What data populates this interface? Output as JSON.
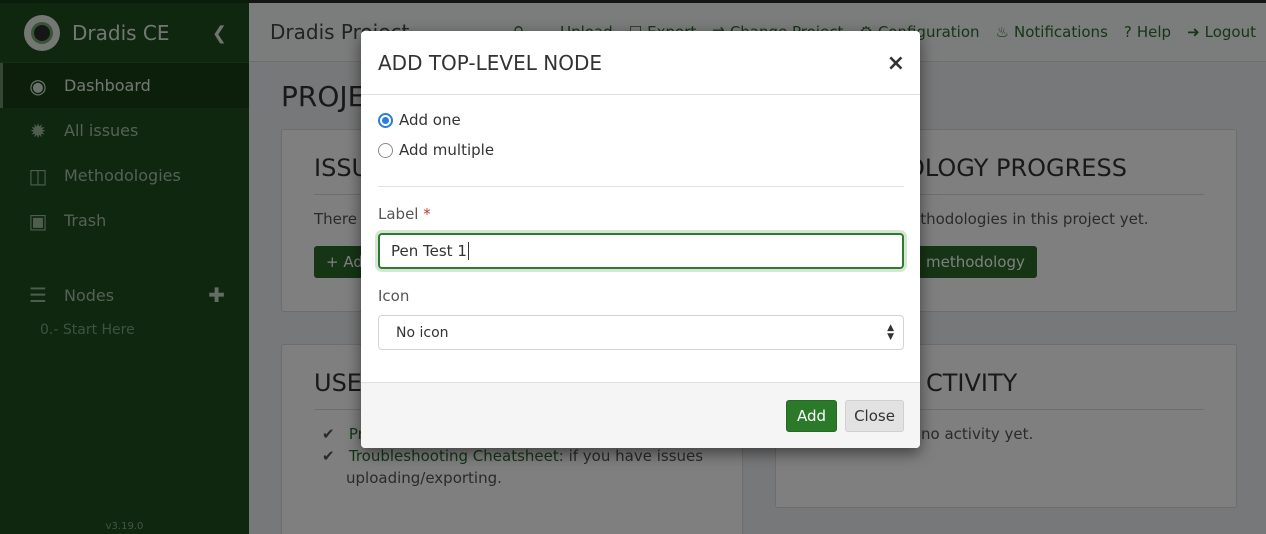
{
  "sidebar": {
    "brand": "Dradis CE",
    "items": [
      {
        "label": "Dashboard",
        "icon": "dashboard-icon"
      },
      {
        "label": "All issues",
        "icon": "bug-icon"
      },
      {
        "label": "Methodologies",
        "icon": "board-icon"
      },
      {
        "label": "Trash",
        "icon": "trash-icon"
      }
    ],
    "nodes_label": "Nodes",
    "nodes": [
      "0.- Start Here"
    ],
    "version": "v3.19.0"
  },
  "topbar": {
    "project_title": "Dradis Project",
    "nav": [
      {
        "label": "Upload",
        "icon": "cloud-upload-icon"
      },
      {
        "label": "Export",
        "icon": "file-export-icon"
      },
      {
        "label": "Change Project",
        "icon": "shuffle-icon"
      },
      {
        "label": "Configuration",
        "icon": "gear-icon"
      },
      {
        "label": "Notifications",
        "icon": "bell-icon"
      },
      {
        "label": "Help",
        "icon": "question-icon"
      },
      {
        "label": "Logout",
        "icon": "logout-icon"
      }
    ]
  },
  "main": {
    "page_heading": "PROJEC",
    "issues_title": "ISSU",
    "issues_text": "There a",
    "issues_button": "+ Ad",
    "methodology_title": "OLOGY PROGRESS",
    "methodology_text": "ethodologies in this project yet.",
    "methodology_button": "methodology",
    "user_title": "USE",
    "user_list": [
      {
        "link": "Pr",
        "rest": ""
      },
      {
        "link": "Troubleshooting Cheatsheet",
        "rest": ": if you have issues"
      }
    ],
    "user_list_cont": "uploading/exporting.",
    "activity_title": "CTIVITY",
    "activity_text": "no activity yet."
  },
  "modal": {
    "title": "ADD TOP-LEVEL NODE",
    "radio_one": "Add one",
    "radio_multiple": "Add multiple",
    "label_label": "Label",
    "label_required": "*",
    "label_value": "Pen Test 1",
    "icon_label": "Icon",
    "icon_value": "No icon",
    "add_button": "Add",
    "close_button": "Close"
  }
}
